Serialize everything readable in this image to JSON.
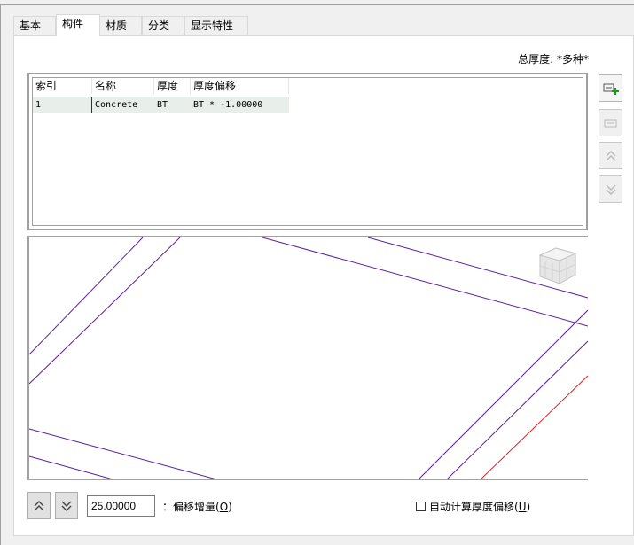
{
  "tabs": [
    {
      "label": "基本"
    },
    {
      "label": "构件"
    },
    {
      "label": "材质"
    },
    {
      "label": "分类"
    },
    {
      "label": "显示特性"
    }
  ],
  "total_thickness": {
    "label": "总厚度:",
    "value": "*多种*"
  },
  "table": {
    "headers": [
      "索引",
      "名称",
      "厚度",
      "厚度偏移"
    ],
    "rows": [
      [
        "1",
        "Concrete",
        "BT",
        "BT * -1.00000"
      ]
    ]
  },
  "side_buttons": [
    {
      "icon": "add-layer-icon",
      "enabled": true
    },
    {
      "icon": "remove-layer-icon",
      "enabled": false
    },
    {
      "icon": "move-up-icon",
      "enabled": false
    },
    {
      "icon": "move-down-icon",
      "enabled": false
    }
  ],
  "colors": {
    "preview_line": "#5a1ea0",
    "preview_highlight": "#e02020"
  },
  "offset": {
    "value": "25.00000",
    "label_prefix": "：偏移增量(",
    "label_key": "O",
    "label_suffix": ")"
  },
  "auto_calc": {
    "label_prefix": "自动计算厚度偏移(",
    "label_key": "U",
    "label_suffix": ")",
    "checked": false
  }
}
